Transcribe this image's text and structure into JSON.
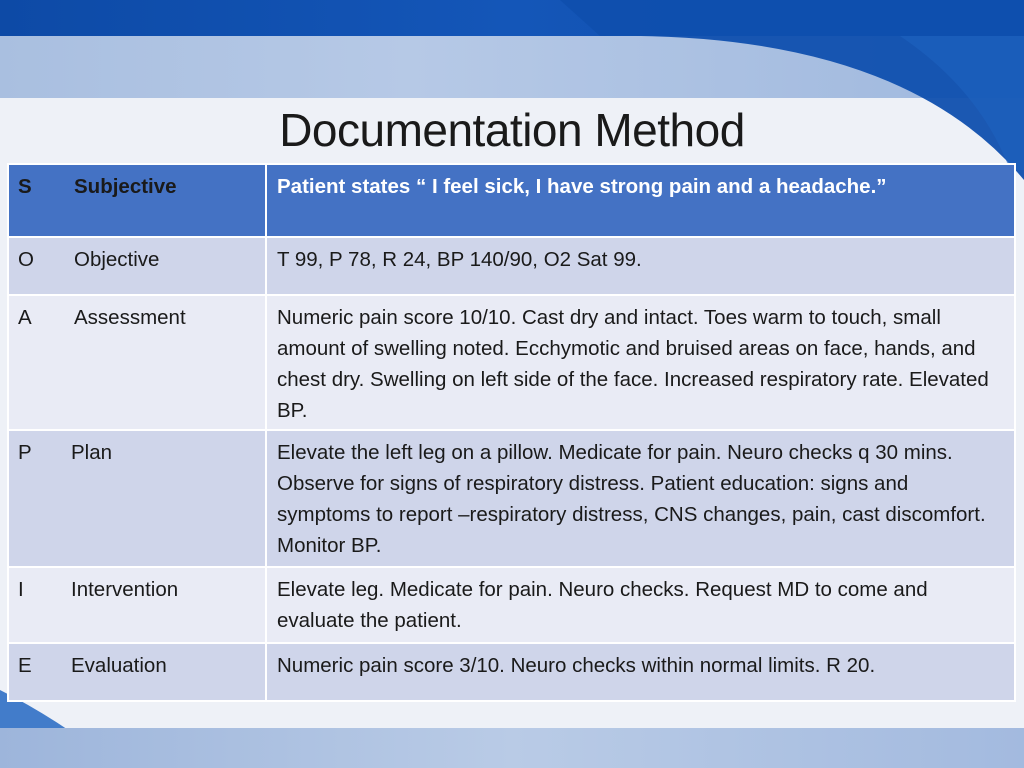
{
  "slide": {
    "title": "Documentation Method"
  },
  "table": {
    "rows": [
      {
        "letter": "S",
        "label": "Subjective",
        "text": "Patient states “ I feel sick, I have strong pain and a headache.”"
      },
      {
        "letter": "O",
        "label": "Objective",
        "text": "T 99, P 78, R 24, BP 140/90, O2 Sat 99."
      },
      {
        "letter": "A",
        "label": "Assessment",
        "text": "Numeric pain score 10/10. Cast dry and intact. Toes warm to touch, small amount of swelling noted. Ecchymotic and bruised areas on face, hands, and chest dry. Swelling on left side of the face. Increased respiratory rate. Elevated BP."
      },
      {
        "letter": "P",
        "label": "Plan",
        "text": "Elevate the left leg on a pillow. Medicate for pain. Neuro checks q 30 mins. Observe for signs of respiratory distress. Patient education: signs and symptoms to report –respiratory distress, CNS changes, pain, cast discomfort. Monitor BP."
      },
      {
        "letter": "I",
        "label": "Intervention",
        "text": "Elevate leg. Medicate for pain. Neuro checks. Request MD to come and evaluate the patient."
      },
      {
        "letter": "E",
        "label": "Evaluation",
        "text": "Numeric pain score 3/10. Neuro checks within normal limits. R 20."
      }
    ]
  },
  "colors": {
    "header_fill": "#4472c4",
    "label_red": "#e10600",
    "row_dark": "#cfd5ea",
    "row_light": "#e9ebf5"
  }
}
